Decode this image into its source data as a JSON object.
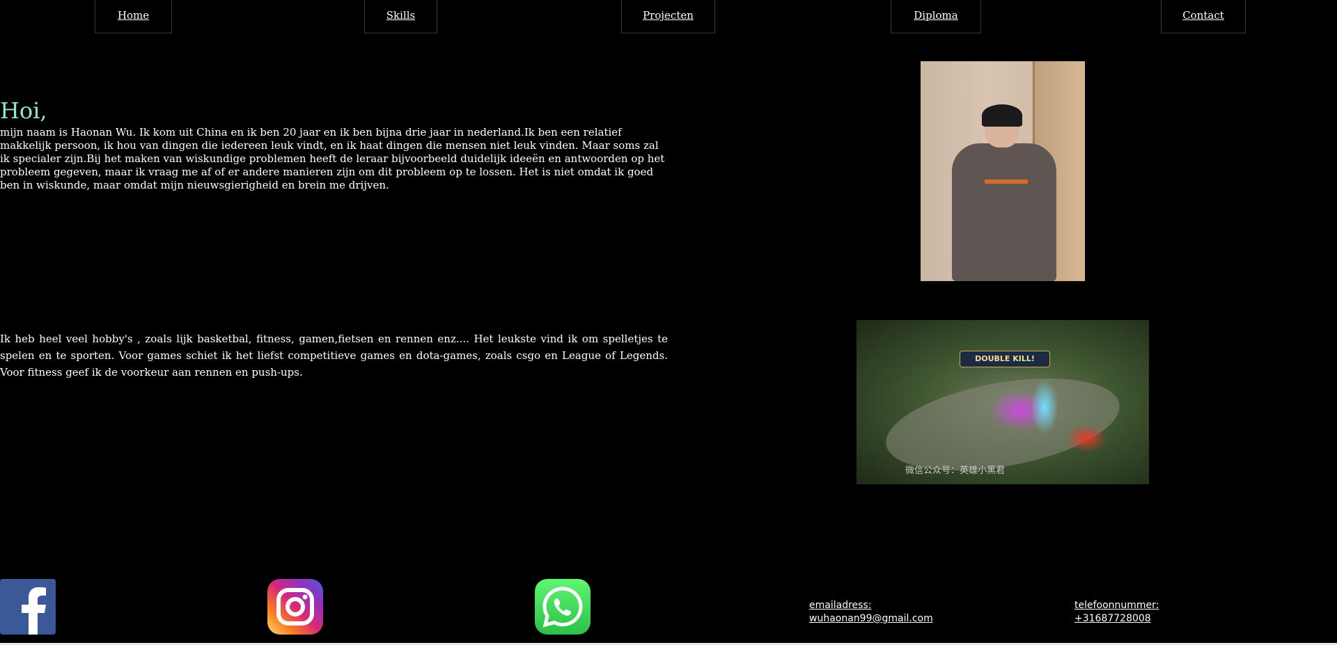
{
  "nav": {
    "items": [
      {
        "label": "Home"
      },
      {
        "label": "Skills"
      },
      {
        "label": "Projecten"
      },
      {
        "label": "Diploma"
      },
      {
        "label": "Contact"
      }
    ]
  },
  "intro": {
    "greeting": "Hoi,",
    "text": "mijn naam is Haonan Wu. Ik kom uit China en ik ben 20 jaar en ik ben bijna drie jaar in nederland.Ik ben een relatief makkelijk persoon, ik hou van dingen die iedereen leuk vindt, en ik haat dingen die mensen niet leuk vinden. Maar soms zal ik specialer zijn.Bij het maken van wiskundige problemen heeft de leraar bijvoorbeeld duidelijk ideeën en antwoorden op het probleem gegeven, maar ik vraag me af of er andere manieren zijn om dit probleem op te lossen. Het is niet omdat ik goed ben in wiskunde, maar omdat mijn nieuwsgierigheid en brein me drijven."
  },
  "hobbies": {
    "text": "Ik heb heel veel hobby's , zoals lijk basketbal, fitness, gamen,fietsen en rennen enz.... Het leukste vind ik om spelletjes te spelen en te sporten. Voor games schiet ik het liefst competitieve games en dota-games, zoals csgo en League of Legends. Voor fitness geef ik de voorkeur aan rennen en push-ups."
  },
  "images": {
    "game_banner": "DOUBLE KILL!",
    "game_caption": "微信公众号：英雄小黑君"
  },
  "social": {
    "icons": [
      "facebook-icon",
      "instagram-icon",
      "whatsapp-icon"
    ]
  },
  "contact": {
    "email_label": "emailadress:",
    "email_value": "wuhaonan99@gmail.com",
    "phone_label": "telefoonnummer:",
    "phone_value": "+31687728008"
  }
}
